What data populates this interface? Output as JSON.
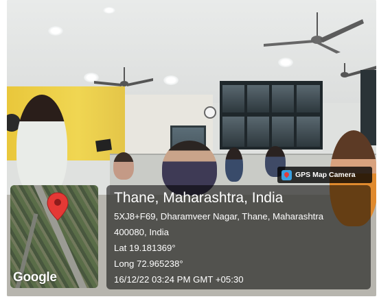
{
  "badge": {
    "icon": "map-pin-icon",
    "label": "GPS Map Camera"
  },
  "map": {
    "brand": "Google",
    "pin_icon": "location-pin-icon",
    "pin_color": "#e53935"
  },
  "location": {
    "title": "Thane, Maharashtra, India",
    "address_line1": "5XJ8+F69, Dharamveer Nagar, Thane, Maharashtra",
    "address_line2": "400080, India",
    "latitude": "Lat 19.181369°",
    "longitude": "Long 72.965238°",
    "timestamp": "16/12/22 03:24 PM GMT +05:30"
  }
}
